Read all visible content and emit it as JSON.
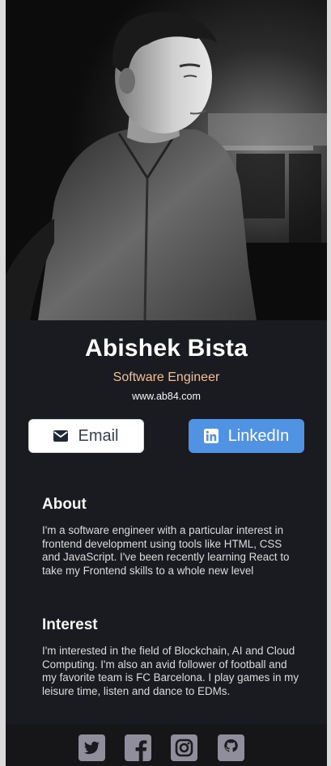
{
  "profile": {
    "photo_alt": "profile-photo",
    "name": "Abishek Bista",
    "title": "Software Engineer",
    "website": "www.ab84.com"
  },
  "buttons": {
    "email_label": "Email",
    "linkedin_label": "LinkedIn"
  },
  "about": {
    "heading": "About",
    "text": "I'm a software engineer with a particular interest in frontend development using tools like HTML, CSS and JavaScript. I've been recently learning React to take my Frontend skills to a whole new level"
  },
  "interest": {
    "heading": "Interest",
    "text": "I'm interested in the field of Blockchain, AI and Cloud Computing. I'm also an avid follower of football and my favorite team is FC Barcelona. I play games in my leisure time, listen and dance to EDMs."
  },
  "social_icons": [
    "twitter-icon",
    "facebook-icon",
    "instagram-icon",
    "github-icon"
  ],
  "colors": {
    "card_bg": "#1a1b21",
    "footer_bg": "#161619",
    "accent": "#f3bf99",
    "linkedin_blue": "#5093e2",
    "icon_gray": "#918e9b"
  }
}
